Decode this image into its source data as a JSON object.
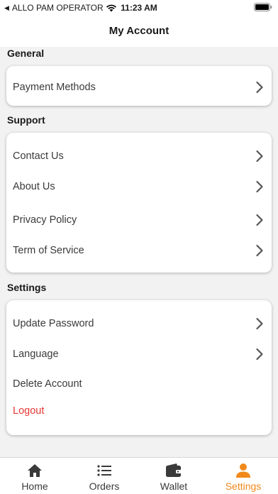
{
  "status_bar": {
    "carrier": "ALLO PAM OPERATOR",
    "time": "11:23 AM"
  },
  "header": {
    "title": "My Account"
  },
  "sections": [
    {
      "title": "General",
      "items": [
        {
          "label": "Payment Methods"
        }
      ]
    },
    {
      "title": "Support",
      "items": [
        {
          "label": "Contact Us"
        },
        {
          "label": "About Us"
        },
        {
          "label": "Privacy Policy"
        },
        {
          "label": "Term of Service"
        }
      ]
    },
    {
      "title": "Settings",
      "items": [
        {
          "label": "Update Password"
        },
        {
          "label": "Language"
        },
        {
          "label": "Delete Account"
        },
        {
          "label": "Logout"
        }
      ]
    }
  ],
  "tabbar": {
    "items": [
      {
        "label": "Home",
        "icon": "home-icon"
      },
      {
        "label": "Orders",
        "icon": "list-icon"
      },
      {
        "label": "Wallet",
        "icon": "wallet-icon"
      },
      {
        "label": "Settings",
        "icon": "person-icon",
        "active": true
      }
    ]
  },
  "colors": {
    "accent": "#f0891a",
    "danger": "#e53935",
    "background": "#f2f2f2"
  }
}
